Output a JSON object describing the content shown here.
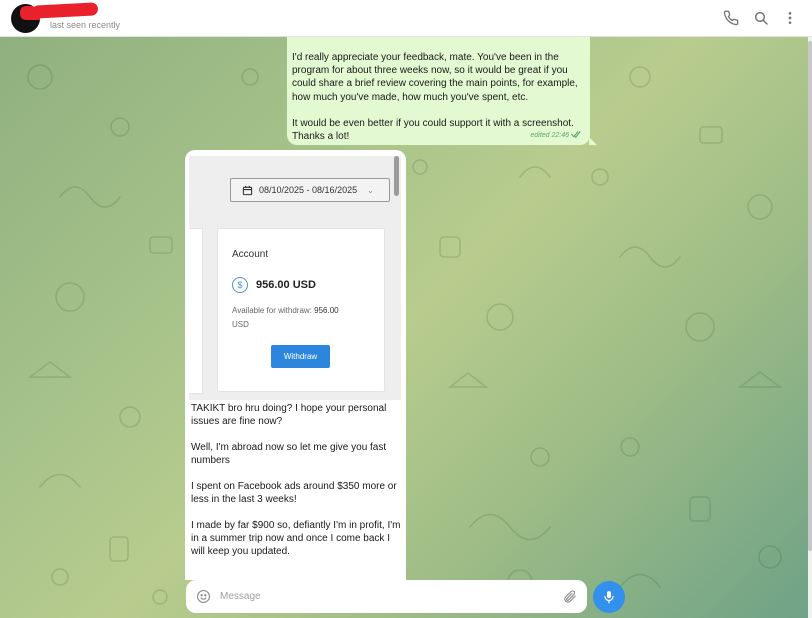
{
  "header": {
    "status": "last seen recently",
    "icons": [
      "phone-icon",
      "search-icon",
      "more-vertical-icon"
    ]
  },
  "messages": {
    "outgoing": {
      "text": "I'd really appreciate your feedback, mate. You've been in the program for about three weeks now, so it would be great if you could share a brief review covering the main points, for example, how much you've made, how much you've spent, etc.\n\nIt would be even better if you could support it with a screenshot. Thanks a lot!",
      "edited_label": "edited",
      "time": "22:46"
    },
    "incoming": {
      "screenshot": {
        "date_range": "08/10/2025 - 08/16/2025",
        "account_title": "Account",
        "amount": "956.00 USD",
        "available_label": "Available for withdraw:",
        "available_value": "956.00",
        "available_unit": "USD",
        "withdraw_label": "Withdraw"
      },
      "paragraphs": [
        "TAKIKT bro hru doing? I hope your personal issues are fine now?",
        "Well, I'm abroad now so let me give you fast numbers",
        "I spent on Facebook ads around $350 more or less in the last 3 weeks!",
        "I made by far $900 so, defiantly I'm in profit, I'm in a summer trip now and once I come back I will keep you updated."
      ]
    }
  },
  "composer": {
    "placeholder": "Message"
  },
  "colors": {
    "accent": "#3390ec",
    "outgoing_bubble": "#e2f9d1",
    "redaction": "#e8212b"
  }
}
